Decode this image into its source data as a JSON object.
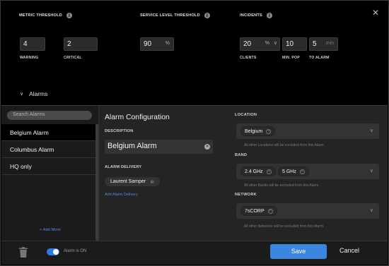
{
  "thresholds": {
    "metric": {
      "title": "METRIC THRESHOLD",
      "warning": {
        "value": "4",
        "label": "WARNING"
      },
      "critical": {
        "value": "2",
        "label": "CRITICAL"
      }
    },
    "service_level": {
      "title": "SERVICE LEVEL THRESHOLD",
      "value": "90",
      "unit": "%"
    },
    "incidents": {
      "title": "INCIDENTS",
      "clients": {
        "value": "20",
        "unit": "%",
        "label": "CLIENTS"
      },
      "min_pop": {
        "value": "10",
        "label": "MIN. POP"
      },
      "to_alarm": {
        "value": "5",
        "unit": "min",
        "label": "TO ALARM"
      }
    },
    "alarms_toggle_label": "Alarms"
  },
  "sidebar": {
    "search_placeholder": "Search Alarms",
    "items": [
      "Belgium Alarm",
      "Columbus Alarm",
      "HQ only"
    ],
    "add_more": "+ Add More"
  },
  "config": {
    "title": "Alarm Configuration",
    "description_label": "DESCRIPTION",
    "description_value": "Belgium Alarm",
    "delivery_label": "ALARM DELIVERY",
    "delivery_chip": "Laurent Samper",
    "add_delivery": "Add Alarm Delivery"
  },
  "filters": {
    "location": {
      "label": "LOCATION",
      "chips": [
        "Belgium"
      ],
      "note": "All other Locations will be excluded from this Alarm."
    },
    "band": {
      "label": "BAND",
      "chips": [
        "2.4 GHz",
        "5 GHz"
      ],
      "note": "All other Bands will be excluded from this Alarm."
    },
    "network": {
      "label": "NETWORK",
      "chips": [
        "7sCORP"
      ],
      "note": "All other Networks will be excluded from this Alarm."
    }
  },
  "footer": {
    "toggle_label": "Alarm is ON",
    "save": "Save",
    "cancel": "Cancel"
  },
  "colors": {
    "accent": "#3b86e0",
    "link": "#4a90e2",
    "background": "#000000",
    "panel": "#242424"
  }
}
